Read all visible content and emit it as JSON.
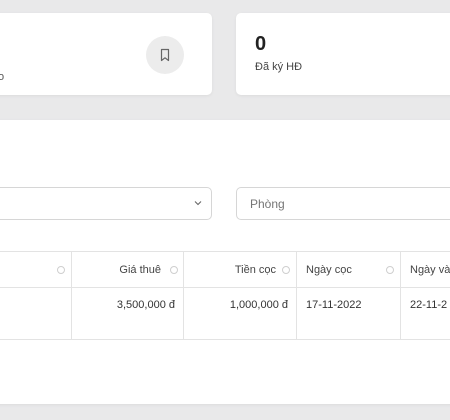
{
  "stats": {
    "left_partial_text": "o",
    "right_value": "0",
    "right_label": "Đã ký HĐ"
  },
  "filters": {
    "select_value": "",
    "room_placeholder": "Phòng"
  },
  "table": {
    "headers": [
      "",
      "Giá thuê",
      "Tiền cọc",
      "Ngày cọc",
      "Ngày và"
    ],
    "rows": [
      [
        "",
        "3,500,000 đ",
        "1,000,000 đ",
        "17-11-2022",
        "22-11-2"
      ]
    ]
  }
}
